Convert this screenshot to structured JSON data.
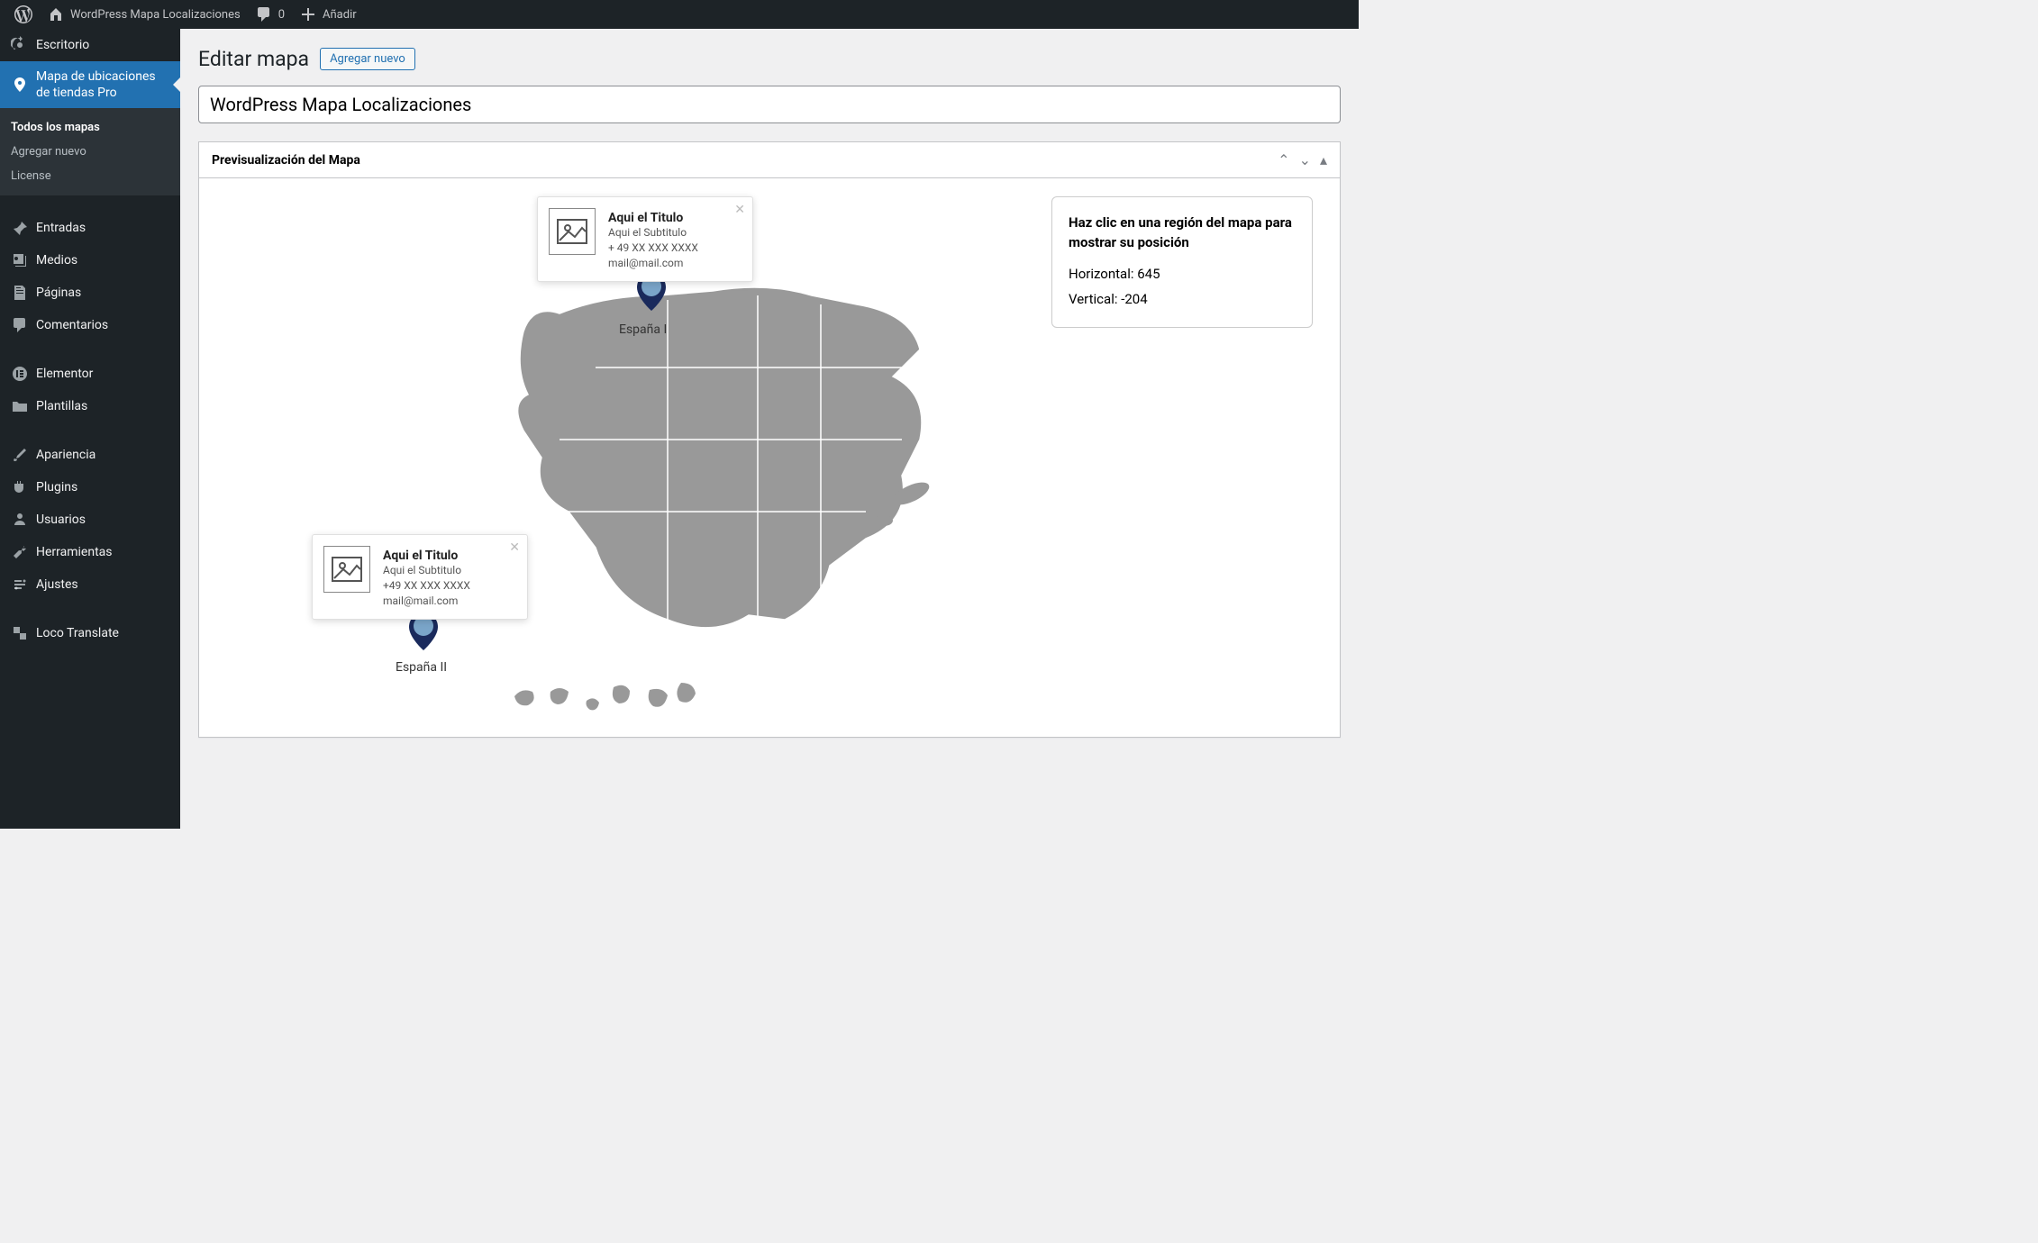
{
  "adminbar": {
    "site_name": "WordPress Mapa Localizaciones",
    "comments": "0",
    "add_new": "Añadir"
  },
  "sidebar": {
    "dashboard": "Escritorio",
    "map_plugin": "Mapa de ubicaciones de tiendas Pro",
    "submenu": {
      "all_maps": "Todos los mapas",
      "add_new": "Agregar nuevo",
      "license": "License"
    },
    "posts": "Entradas",
    "media": "Medios",
    "pages": "Páginas",
    "comments": "Comentarios",
    "elementor": "Elementor",
    "templates": "Plantillas",
    "appearance": "Apariencia",
    "plugins": "Plugins",
    "users": "Usuarios",
    "tools": "Herramientas",
    "settings": "Ajustes",
    "loco": "Loco Translate"
  },
  "page": {
    "heading": "Editar mapa",
    "add_new_btn": "Agregar nuevo",
    "title_value": "WordPress Mapa Localizaciones",
    "preview_label": "Previsualización del Mapa"
  },
  "infobox": {
    "lead": "Haz clic en una región del mapa para mostrar su posición",
    "h_label": "Horizontal:",
    "h_value": "645",
    "v_label": "Vertical:",
    "v_value": "-204"
  },
  "popups": [
    {
      "title": "Aqui el Titulo",
      "subtitle": "Aqui el Subtitulo",
      "phone": "+ 49 XX XXX XXXX",
      "email": "mail@mail.com"
    },
    {
      "title": "Aqui el Titulo",
      "subtitle": "Aqui el Subtitulo",
      "phone": "+49 XX XXX XXXX",
      "email": "mail@mail.com"
    }
  ],
  "markers": [
    {
      "label": "España I"
    },
    {
      "label": "España II"
    }
  ]
}
